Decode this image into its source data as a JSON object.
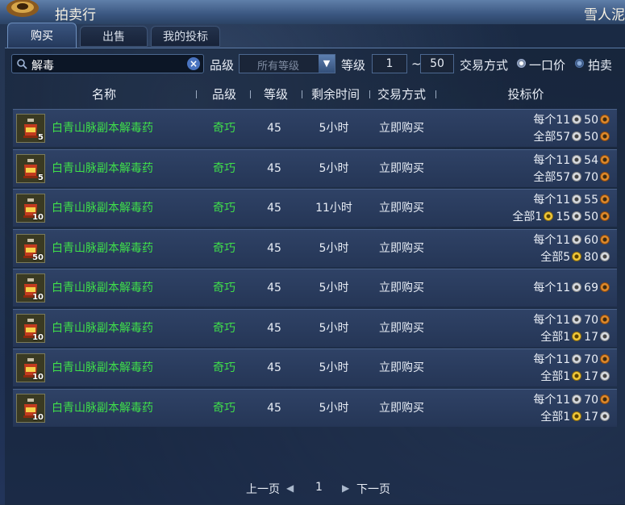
{
  "window": {
    "title": "拍卖行",
    "server": "雪人泥"
  },
  "tabs": [
    {
      "label": "购买",
      "active": true
    },
    {
      "label": "出售",
      "active": false
    },
    {
      "label": "我的投标",
      "active": false
    }
  ],
  "filters": {
    "search_value": "解毒",
    "grade_label": "品级",
    "grade_value": "所有等级",
    "level_label": "等级",
    "level_min": "1",
    "level_sep": "~",
    "level_max": "50",
    "trade_label": "交易方式",
    "trade_options": [
      "一口价",
      "拍卖"
    ],
    "trade_selected": "一口价"
  },
  "columns": [
    "名称",
    "品级",
    "等级",
    "剩余时间",
    "交易方式",
    "投标价"
  ],
  "rows": [
    {
      "count": "5",
      "name": "白青山脉副本解毒药",
      "grade": "奇巧",
      "level": "45",
      "time": "5小时",
      "mode": "立即购买",
      "price1": {
        "label": "每个11",
        "mid": "",
        "last": "50"
      },
      "price2": {
        "label": "全部57",
        "mid": "",
        "last": "50"
      }
    },
    {
      "count": "5",
      "name": "白青山脉副本解毒药",
      "grade": "奇巧",
      "level": "45",
      "time": "5小时",
      "mode": "立即购买",
      "price1": {
        "label": "每个11",
        "mid": "",
        "last": "54"
      },
      "price2": {
        "label": "全部57",
        "mid": "",
        "last": "70"
      }
    },
    {
      "count": "10",
      "name": "白青山脉副本解毒药",
      "grade": "奇巧",
      "level": "45",
      "time": "11小时",
      "mode": "立即购买",
      "price1": {
        "label": "每个11",
        "mid": "",
        "last": "55"
      },
      "price2": {
        "label": "全部1",
        "mid": "15",
        "last": "50"
      }
    },
    {
      "count": "50",
      "name": "白青山脉副本解毒药",
      "grade": "奇巧",
      "level": "45",
      "time": "5小时",
      "mode": "立即购买",
      "price1": {
        "label": "每个11",
        "mid": "",
        "last": "60"
      },
      "price2": {
        "label": "全部5",
        "mid": "",
        "last": "80"
      }
    },
    {
      "count": "10",
      "name": "白青山脉副本解毒药",
      "grade": "奇巧",
      "level": "45",
      "time": "5小时",
      "mode": "立即购买",
      "price1": {
        "label": "每个11",
        "mid": "",
        "last": "69"
      },
      "price2": null
    },
    {
      "count": "10",
      "name": "白青山脉副本解毒药",
      "grade": "奇巧",
      "level": "45",
      "time": "5小时",
      "mode": "立即购买",
      "price1": {
        "label": "每个11",
        "mid": "",
        "last": "70"
      },
      "price2": {
        "label": "全部1",
        "mid": "",
        "last": "17"
      }
    },
    {
      "count": "10",
      "name": "白青山脉副本解毒药",
      "grade": "奇巧",
      "level": "45",
      "time": "5小时",
      "mode": "立即购买",
      "price1": {
        "label": "每个11",
        "mid": "",
        "last": "70"
      },
      "price2": {
        "label": "全部1",
        "mid": "",
        "last": "17"
      }
    },
    {
      "count": "10",
      "name": "白青山脉副本解毒药",
      "grade": "奇巧",
      "level": "45",
      "time": "5小时",
      "mode": "立即购买",
      "price1": {
        "label": "每个11",
        "mid": "",
        "last": "70"
      },
      "price2": {
        "label": "全部1",
        "mid": "",
        "last": "17"
      }
    }
  ],
  "pagination": {
    "prev": "上一页",
    "page": "1",
    "next": "下一页"
  },
  "colors": {
    "item_name": "#3fe04a",
    "grade": "#3fe04a",
    "text": "#e8edf5"
  }
}
